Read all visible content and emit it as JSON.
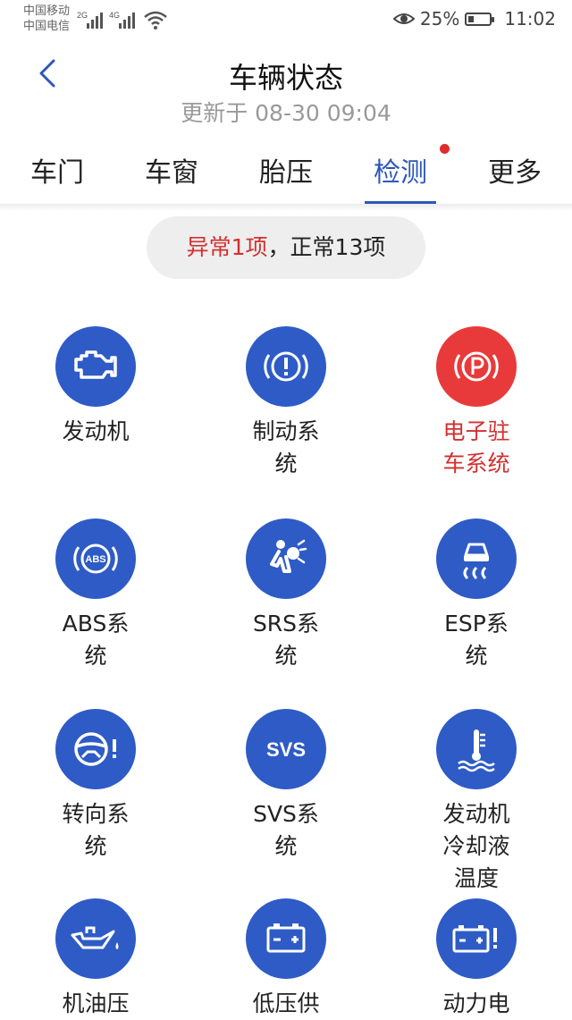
{
  "status_bar": {
    "carrier_1": "中国移动",
    "carrier_2": "中国电信",
    "net_1": "2G",
    "net_2": "4G",
    "battery_percent": "25%",
    "battery_level": 0.25,
    "time": "11:02"
  },
  "header": {
    "title": "车辆状态",
    "subtitle": "更新于 08-30 09:04"
  },
  "tabs": [
    {
      "label": "车门"
    },
    {
      "label": "车窗"
    },
    {
      "label": "胎压"
    },
    {
      "label": "检测",
      "active": true,
      "has_dot": true
    },
    {
      "label": "更多"
    }
  ],
  "summary": {
    "abnormal": "异常1项",
    "separator": "，",
    "normal": "正常13项"
  },
  "colors": {
    "accent": "#2d57b8",
    "icon_normal": "#2e5bc6",
    "icon_abnormal": "#e83a3a",
    "text_abnormal": "#d33030"
  },
  "items": [
    {
      "icon": "engine-icon",
      "label_lines": [
        "发动机"
      ],
      "status": "normal"
    },
    {
      "icon": "brake-warning-icon",
      "label_lines": [
        "制动系",
        "统"
      ],
      "status": "normal"
    },
    {
      "icon": "parking-brake-icon",
      "label_lines": [
        "电子驻",
        "车系统"
      ],
      "status": "abnormal"
    },
    {
      "icon": "abs-icon",
      "label_lines": [
        "ABS系",
        "统"
      ],
      "status": "normal"
    },
    {
      "icon": "airbag-icon",
      "label_lines": [
        "SRS系",
        "统"
      ],
      "status": "normal"
    },
    {
      "icon": "esp-icon",
      "label_lines": [
        "ESP系",
        "统"
      ],
      "status": "normal"
    },
    {
      "icon": "steering-warning-icon",
      "label_lines": [
        "转向系",
        "统"
      ],
      "status": "normal"
    },
    {
      "icon": "svs-icon",
      "icon_text": "SVS",
      "label_lines": [
        "SVS系",
        "统"
      ],
      "status": "normal"
    },
    {
      "icon": "coolant-temp-icon",
      "label_lines": [
        "发动机",
        "冷却液",
        "温度"
      ],
      "status": "normal"
    },
    {
      "icon": "oil-pressure-icon",
      "label_lines": [
        "机油压"
      ],
      "status": "normal"
    },
    {
      "icon": "battery-icon",
      "label_lines": [
        "低压供"
      ],
      "status": "normal"
    },
    {
      "icon": "power-battery-icon",
      "label_lines": [
        "动力电"
      ],
      "status": "normal"
    }
  ]
}
